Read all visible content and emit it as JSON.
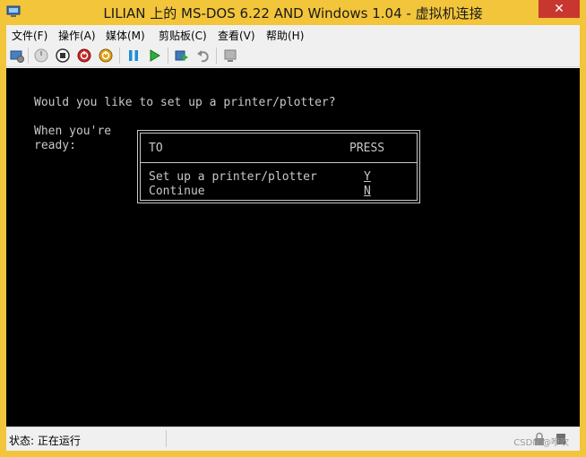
{
  "window": {
    "title": "LILIAN 上的 MS-DOS 6.22 AND Windows 1.04 - 虚拟机连接",
    "close_glyph": "✕"
  },
  "menubar": {
    "items": [
      "文件(F)",
      "操作(A)",
      "媒体(M)",
      "剪贴板(C)",
      "查看(V)",
      "帮助(H)"
    ]
  },
  "toolbar": {
    "icons": [
      "ctrl-alt-del-icon",
      "start-icon",
      "turn-off-icon",
      "shutdown-icon",
      "save-state-icon",
      "pause-icon",
      "resume-icon",
      "checkpoint-icon",
      "revert-icon",
      "enhanced-session-icon"
    ]
  },
  "console": {
    "question": "Would you like to set up a printer/plotter?",
    "prompt_line1": "When you're",
    "prompt_line2": "ready:",
    "dialog": {
      "col_to": "TO",
      "col_press": "PRESS",
      "rows": [
        {
          "action": "Set up a printer/plotter",
          "key": "Y"
        },
        {
          "action": "Continue",
          "key": "N"
        }
      ]
    }
  },
  "statusbar": {
    "status": "状态: 正在运行",
    "watermark": "CSDN @咿吹"
  }
}
